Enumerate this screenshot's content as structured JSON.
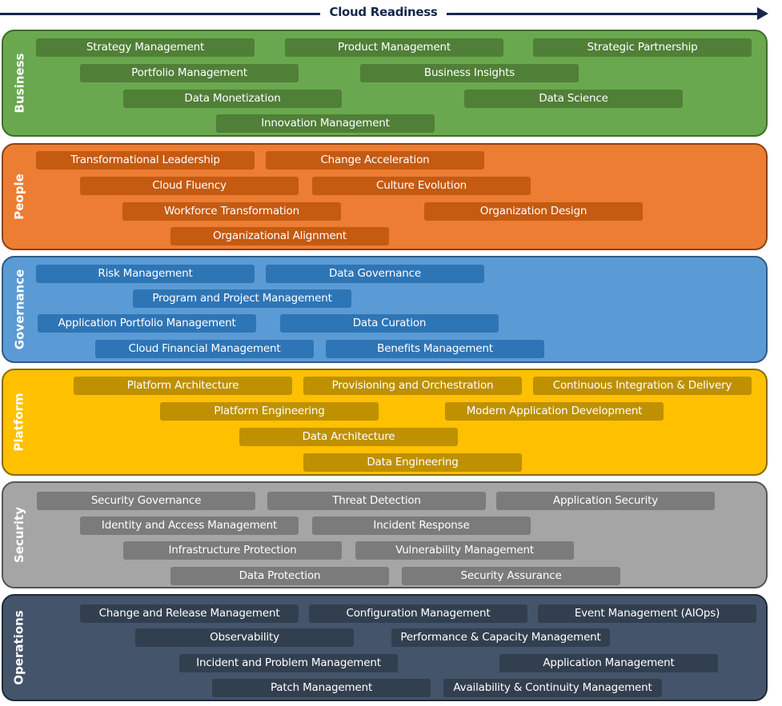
{
  "header": {
    "title": "Cloud Readiness"
  },
  "colors": {
    "arrow": "#16274a",
    "business": {
      "band": "#6aa84f",
      "border": "#3f6d2a",
      "box": "#507f37"
    },
    "people": {
      "band": "#ec7d33",
      "border": "#8a4313",
      "box": "#c55a11"
    },
    "governance": {
      "band": "#5b9bd5",
      "border": "#2e5a87",
      "box": "#2e75b6"
    },
    "platform": {
      "band": "#ffc000",
      "border": "#8a6b00",
      "box": "#bf9000"
    },
    "security": {
      "band": "#a5a5a5",
      "border": "#555555",
      "box": "#7b7b7b"
    },
    "operations": {
      "band": "#44546a",
      "border": "#1f2a38",
      "box": "#323f4f"
    }
  },
  "bands": [
    {
      "id": "business",
      "label": "Business",
      "capabilities": [
        "Strategy Management",
        "Product Management",
        "Strategic Partnership",
        "Portfolio Management",
        "Business Insights",
        "Data Monetization",
        "Data Science",
        "Innovation Management"
      ]
    },
    {
      "id": "people",
      "label": "People",
      "capabilities": [
        "Transformational Leadership",
        "Change Acceleration",
        "Cloud Fluency",
        "Culture Evolution",
        "Workforce Transformation",
        "Organization Design",
        "Organizational Alignment"
      ]
    },
    {
      "id": "governance",
      "label": "Governance",
      "capabilities": [
        "Risk Management",
        "Data Governance",
        "Program and Project Management",
        "Application Portfolio Management",
        "Data Curation",
        "Cloud Financial Management",
        "Benefits Management"
      ]
    },
    {
      "id": "platform",
      "label": "Platform",
      "capabilities": [
        "Platform Architecture",
        "Provisioning and Orchestration",
        "Continuous Integration & Delivery",
        "Platform Engineering",
        "Modern Application Development",
        "Data Architecture",
        "Data Engineering"
      ]
    },
    {
      "id": "security",
      "label": "Security",
      "capabilities": [
        "Security Governance",
        "Threat Detection",
        "Application Security",
        "Identity and Access Management",
        "Incident Response",
        "Infrastructure Protection",
        "Vulnerability Management",
        "Data Protection",
        "Security Assurance"
      ]
    },
    {
      "id": "operations",
      "label": "Operations",
      "capabilities": [
        "Change and Release Management",
        "Configuration Management",
        "Event Management (AIOps)",
        "Observability",
        "Performance & Capacity Management",
        "Incident and Problem Management",
        "Application Management",
        "Patch Management",
        "Availability & Continuity Management"
      ]
    }
  ]
}
